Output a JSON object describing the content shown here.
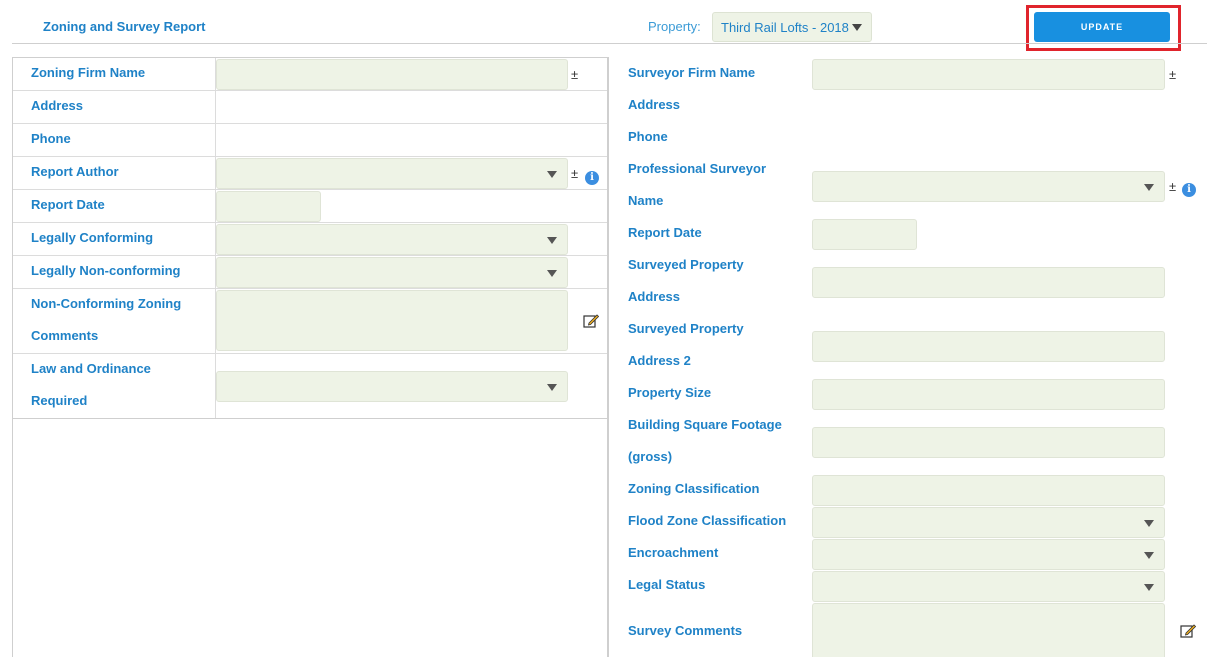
{
  "header": {
    "title": "Zoning and Survey Report",
    "property_label": "Property:",
    "property_value": "Third Rail Lofts - 2018",
    "update_label": "UPDATE"
  },
  "zoning": {
    "firm_name": "Zoning Firm Name",
    "address": "Address",
    "phone": "Phone",
    "report_author": "Report Author",
    "report_date": "Report Date",
    "legally_conforming": "Legally Conforming",
    "legally_nonconforming": "Legally Non-conforming",
    "nonconforming_comments_1": "Non-Conforming Zoning",
    "nonconforming_comments_2": "Comments",
    "law_ordinance_1": "Law and Ordinance",
    "law_ordinance_2": "Required"
  },
  "survey": {
    "firm_name": "Surveyor Firm Name",
    "address": "Address",
    "phone": "Phone",
    "professional_surveyor_1": "Professional Surveyor",
    "professional_surveyor_2": "Name",
    "report_date": "Report Date",
    "surveyed_address_1": "Surveyed Property",
    "surveyed_address_2": "Address",
    "surveyed_address2_1": "Surveyed Property",
    "surveyed_address2_2": "Address 2",
    "property_size": "Property Size",
    "building_sqft_1": "Building Square Footage",
    "building_sqft_2": "(gross)",
    "zoning_classification": "Zoning Classification",
    "flood_zone": "Flood Zone Classification",
    "encroachment": "Encroachment",
    "legal_status": "Legal Status",
    "survey_comments": "Survey Comments"
  },
  "icons": {
    "plus_minus": "±",
    "info": "i"
  },
  "colors": {
    "label": "#1f82c7",
    "field_bg": "#eef3e6",
    "button": "#1890e0",
    "highlight": "#e0242c"
  }
}
